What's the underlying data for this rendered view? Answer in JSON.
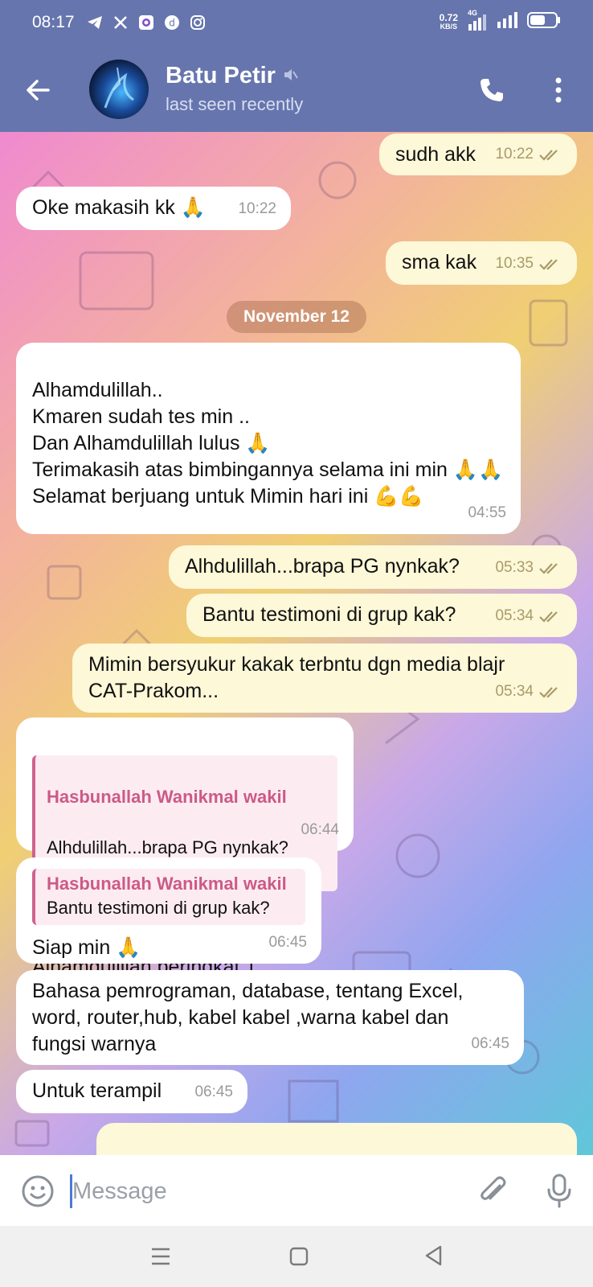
{
  "status_bar": {
    "time": "08:17",
    "net_speed_value": "0.72",
    "net_speed_unit": "KB/S",
    "network": "4G",
    "icons": [
      "telegram-icon",
      "x-icon",
      "app-icon",
      "app2-icon",
      "instagram-icon"
    ]
  },
  "header": {
    "name": "Batu Petir",
    "status": "last seen recently",
    "muted": true
  },
  "colors": {
    "header_bg": "#6675ad",
    "incoming_bubble": "#ffffff",
    "outgoing_bubble": "#fdf8d8",
    "reply_accent": "#cc5a86"
  },
  "messages": [
    {
      "dir": "out",
      "text": "sudh akk",
      "time": "10:22",
      "read": true
    },
    {
      "dir": "in",
      "text": "Oke makasih kk 🙏",
      "time": "10:22"
    },
    {
      "dir": "out",
      "text": "sma kak",
      "time": "10:35",
      "read": true
    },
    {
      "date": "November 12"
    },
    {
      "dir": "in",
      "text": "Alhamdulillah..\nKmaren sudah tes min ..\nDan Alhamdulillah lulus 🙏\nTerimakasih atas bimbingannya selama ini min 🙏🙏\nSelamat berjuang untuk Mimin hari ini 💪💪",
      "time": "04:55"
    },
    {
      "dir": "out",
      "text": "Alhdulillah...brapa PG nynkak?",
      "time": "05:33",
      "read": true
    },
    {
      "dir": "out",
      "text": "Bantu testimoni di grup kak?",
      "time": "05:34",
      "read": true
    },
    {
      "dir": "out",
      "text": "Mimin bersyukur kakak terbntu dgn media blajr CAT-Prakom...",
      "time": "05:34",
      "read": true
    },
    {
      "dir": "in",
      "reply_name": "Hasbunallah Wanikmal wakil",
      "reply_text": "Alhdulillah...brapa PG nynkak?",
      "text": "514 min.\nAlhamdulillah peringkat 1",
      "time": "06:44"
    },
    {
      "dir": "in",
      "reply_name": "Hasbunallah Wanikmal wakil",
      "reply_text": "Bantu testimoni di grup kak?",
      "text": "Siap min 🙏",
      "time": "06:45"
    },
    {
      "dir": "in",
      "text": "Bahasa pemrograman, database, tentang Excel, word, router,hub, kabel kabel ,warna kabel dan fungsi warnya",
      "time": "06:45"
    },
    {
      "dir": "in",
      "text": "Untuk terampil",
      "time": "06:45"
    }
  ],
  "input": {
    "placeholder": "Message",
    "value": ""
  }
}
